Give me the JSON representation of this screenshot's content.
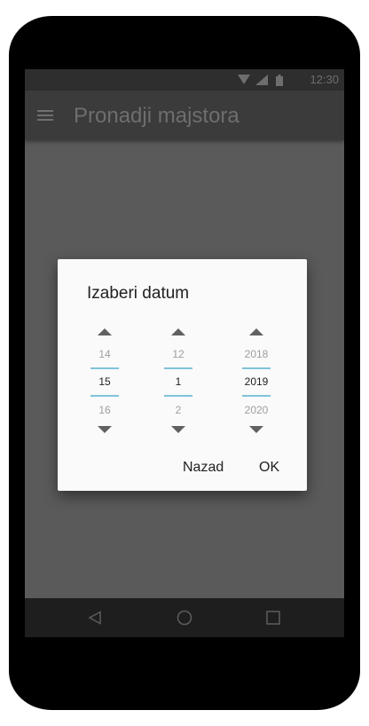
{
  "status_bar": {
    "time": "12:30"
  },
  "app_bar": {
    "title": "Pronadji majstora"
  },
  "dialog": {
    "title": "Izaberi datum",
    "day": {
      "prev": "14",
      "current": "15",
      "next": "16"
    },
    "month": {
      "prev": "12",
      "current": "1",
      "next": "2"
    },
    "year": {
      "prev": "2018",
      "current": "2019",
      "next": "2020"
    },
    "cancel_label": "Nazad",
    "ok_label": "OK"
  },
  "nav_bar": {
    "icons": [
      "back-icon",
      "home-icon",
      "recents-icon"
    ]
  },
  "colors": {
    "accent_line": "#80c3da",
    "dialog_bg": "#fafafa",
    "dim_bg": "#5a5a5a"
  }
}
